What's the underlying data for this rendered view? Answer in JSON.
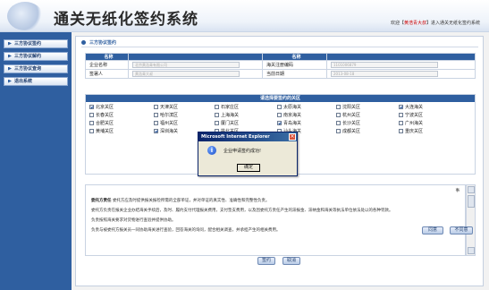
{
  "header": {
    "app_title": "通关无纸化签约系统",
    "welcome_prefix": "欢迎【",
    "welcome_user": "黄浩青大叔",
    "welcome_suffix": "】进入通关无纸化签约系统"
  },
  "sidebar": {
    "items": [
      {
        "label": "三方协议签约"
      },
      {
        "label": "三方协议解约"
      },
      {
        "label": "三方协议查询"
      },
      {
        "label": "退出系统"
      }
    ]
  },
  "main": {
    "section_title": "三方协议签约",
    "info_table": {
      "headers": [
        "名称",
        "",
        "名称",
        ""
      ],
      "rows": [
        {
          "label1": "企业名称",
          "value1": "北京黄浩青有限公司",
          "label2": "海关注册编码",
          "value2": "1101006879"
        },
        {
          "label1": "签署人",
          "value1": "黄浩青大叔",
          "label2": "当前日期",
          "value2": "2013-08-18"
        }
      ]
    },
    "customs_header": "请选择要签约的关区",
    "customs": [
      {
        "name": "北京关区",
        "checked": true
      },
      {
        "name": "天津关区",
        "checked": false
      },
      {
        "name": "石家庄区",
        "checked": false
      },
      {
        "name": "太原海关",
        "checked": false
      },
      {
        "name": "沈阳关区",
        "checked": false
      },
      {
        "name": "大连海关",
        "checked": true
      },
      {
        "name": "长春关区",
        "checked": false
      },
      {
        "name": "哈尔滨区",
        "checked": false
      },
      {
        "name": "上海海关",
        "checked": false
      },
      {
        "name": "南京海关",
        "checked": false
      },
      {
        "name": "杭州关区",
        "checked": false
      },
      {
        "name": "宁波关区",
        "checked": false
      },
      {
        "name": "合肥关区",
        "checked": false
      },
      {
        "name": "福州关区",
        "checked": false
      },
      {
        "name": "厦门关区",
        "checked": false
      },
      {
        "name": "青岛海关",
        "checked": true
      },
      {
        "name": "长沙关区",
        "checked": false
      },
      {
        "name": "广州海关",
        "checked": false
      },
      {
        "name": "黄埔关区",
        "checked": false
      },
      {
        "name": "深圳海关",
        "checked": true
      },
      {
        "name": "拱北关区",
        "checked": false
      },
      {
        "name": "汕头海关",
        "checked": false
      },
      {
        "name": "成都关区",
        "checked": false
      },
      {
        "name": "重庆关区",
        "checked": false
      }
    ],
    "agreement_title": "事",
    "agreement": [
      {
        "lead": "委托方责任",
        "text": "委托方应及时提供报关报检所需的全部单证，并对单证的真实性、准确性和完整性负责。"
      },
      {
        "lead": "",
        "text": "委托方负责在报关企业办结海关手续后，及时、履约支付代理报关费用，支付垫支费用，以及因委托方责任产生的滞报金、滞纳金和海关等执法单位依法处以的各种罚款。"
      },
      {
        "lead": "",
        "text": "负责按照海关要求对货物进行查验并提供协助。"
      },
      {
        "lead": "",
        "text": "负责与被委托方报关员一同协助海关进行查验，回答海关的询问，配合相关调查，并承担产生的相关费用。"
      }
    ],
    "buttons": {
      "agree": "同意",
      "disagree": "不同意",
      "sign": "签约",
      "cancel": "取消"
    }
  },
  "dialog": {
    "title": "Microsoft Internet Explorer",
    "message": "企业申请签约成功!",
    "ok": "确定"
  },
  "colors": {
    "accent": "#2f5fa0",
    "sidebar_bg": "#2f5fa0",
    "dialog_title": "#0a246a"
  }
}
